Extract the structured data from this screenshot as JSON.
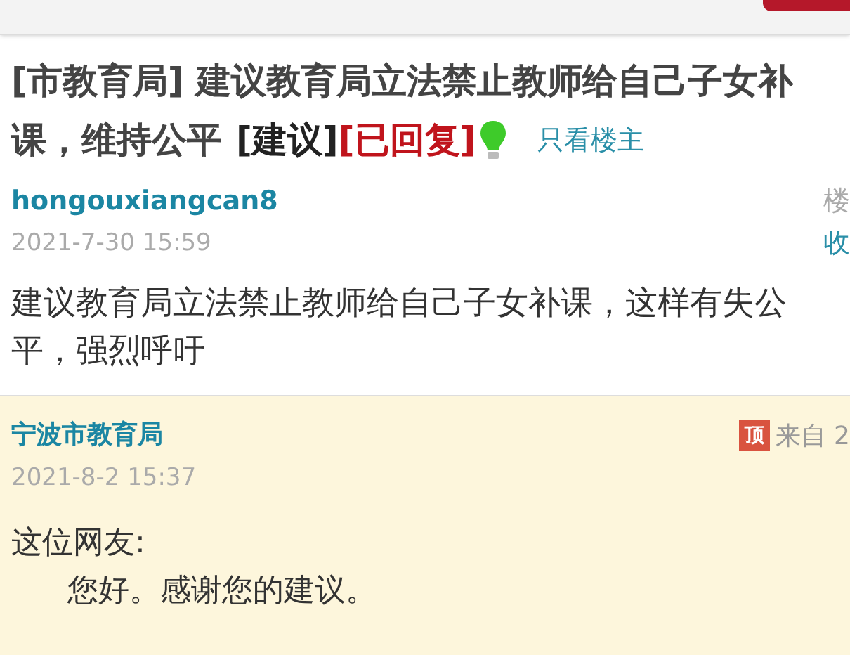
{
  "post": {
    "title_lines": [
      "[市教育局] 建议教育局立法禁止教师给自己子女补",
      "课，维持公平"
    ],
    "category": "[建议]",
    "status": "[已回复]",
    "author_only_link": "只看楼主",
    "author": "hongouxiangcan8",
    "floor_label": "楼",
    "favorite": "收",
    "date": "2021-7-30 15:59",
    "body": "建议教育局立法禁止教师给自己子女补课，这样有失公平，强烈呼吁"
  },
  "reply": {
    "author": "宁波市教育局",
    "badge": "顶",
    "source": "来自 2",
    "date": "2021-8-2 15:37",
    "greeting": "这位网友:",
    "body": "您好。感谢您的建议。"
  }
}
